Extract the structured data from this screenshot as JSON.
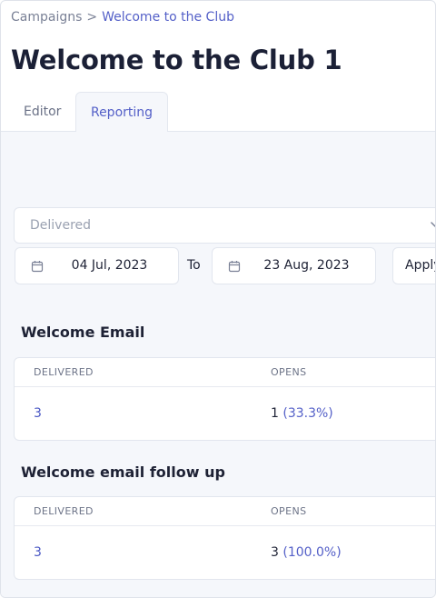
{
  "breadcrumb": {
    "parent": "Campaigns",
    "separator": ">",
    "current": "Welcome to the Club"
  },
  "page_title": "Welcome to the Club 1",
  "tabs": [
    {
      "label": "Editor",
      "active": false
    },
    {
      "label": "Reporting",
      "active": true
    }
  ],
  "filter": {
    "metric_select": "Delivered",
    "start_date": "04 Jul, 2023",
    "to_label": "To",
    "end_date": "23 Aug, 2023",
    "apply_label": "Apply"
  },
  "emails": [
    {
      "title": "Welcome Email",
      "headers": [
        "DELIVERED",
        "OPENS"
      ],
      "delivered": "3",
      "opens_count": "1",
      "opens_pct": "(33.3%)"
    },
    {
      "title": "Welcome email follow up",
      "headers": [
        "DELIVERED",
        "OPENS"
      ],
      "delivered": "3",
      "opens_count": "3",
      "opens_pct": "(100.0%)"
    }
  ],
  "colors": {
    "accent": "#5460c8",
    "content_bg": "#f5f7fb",
    "title": "#1b2036"
  }
}
